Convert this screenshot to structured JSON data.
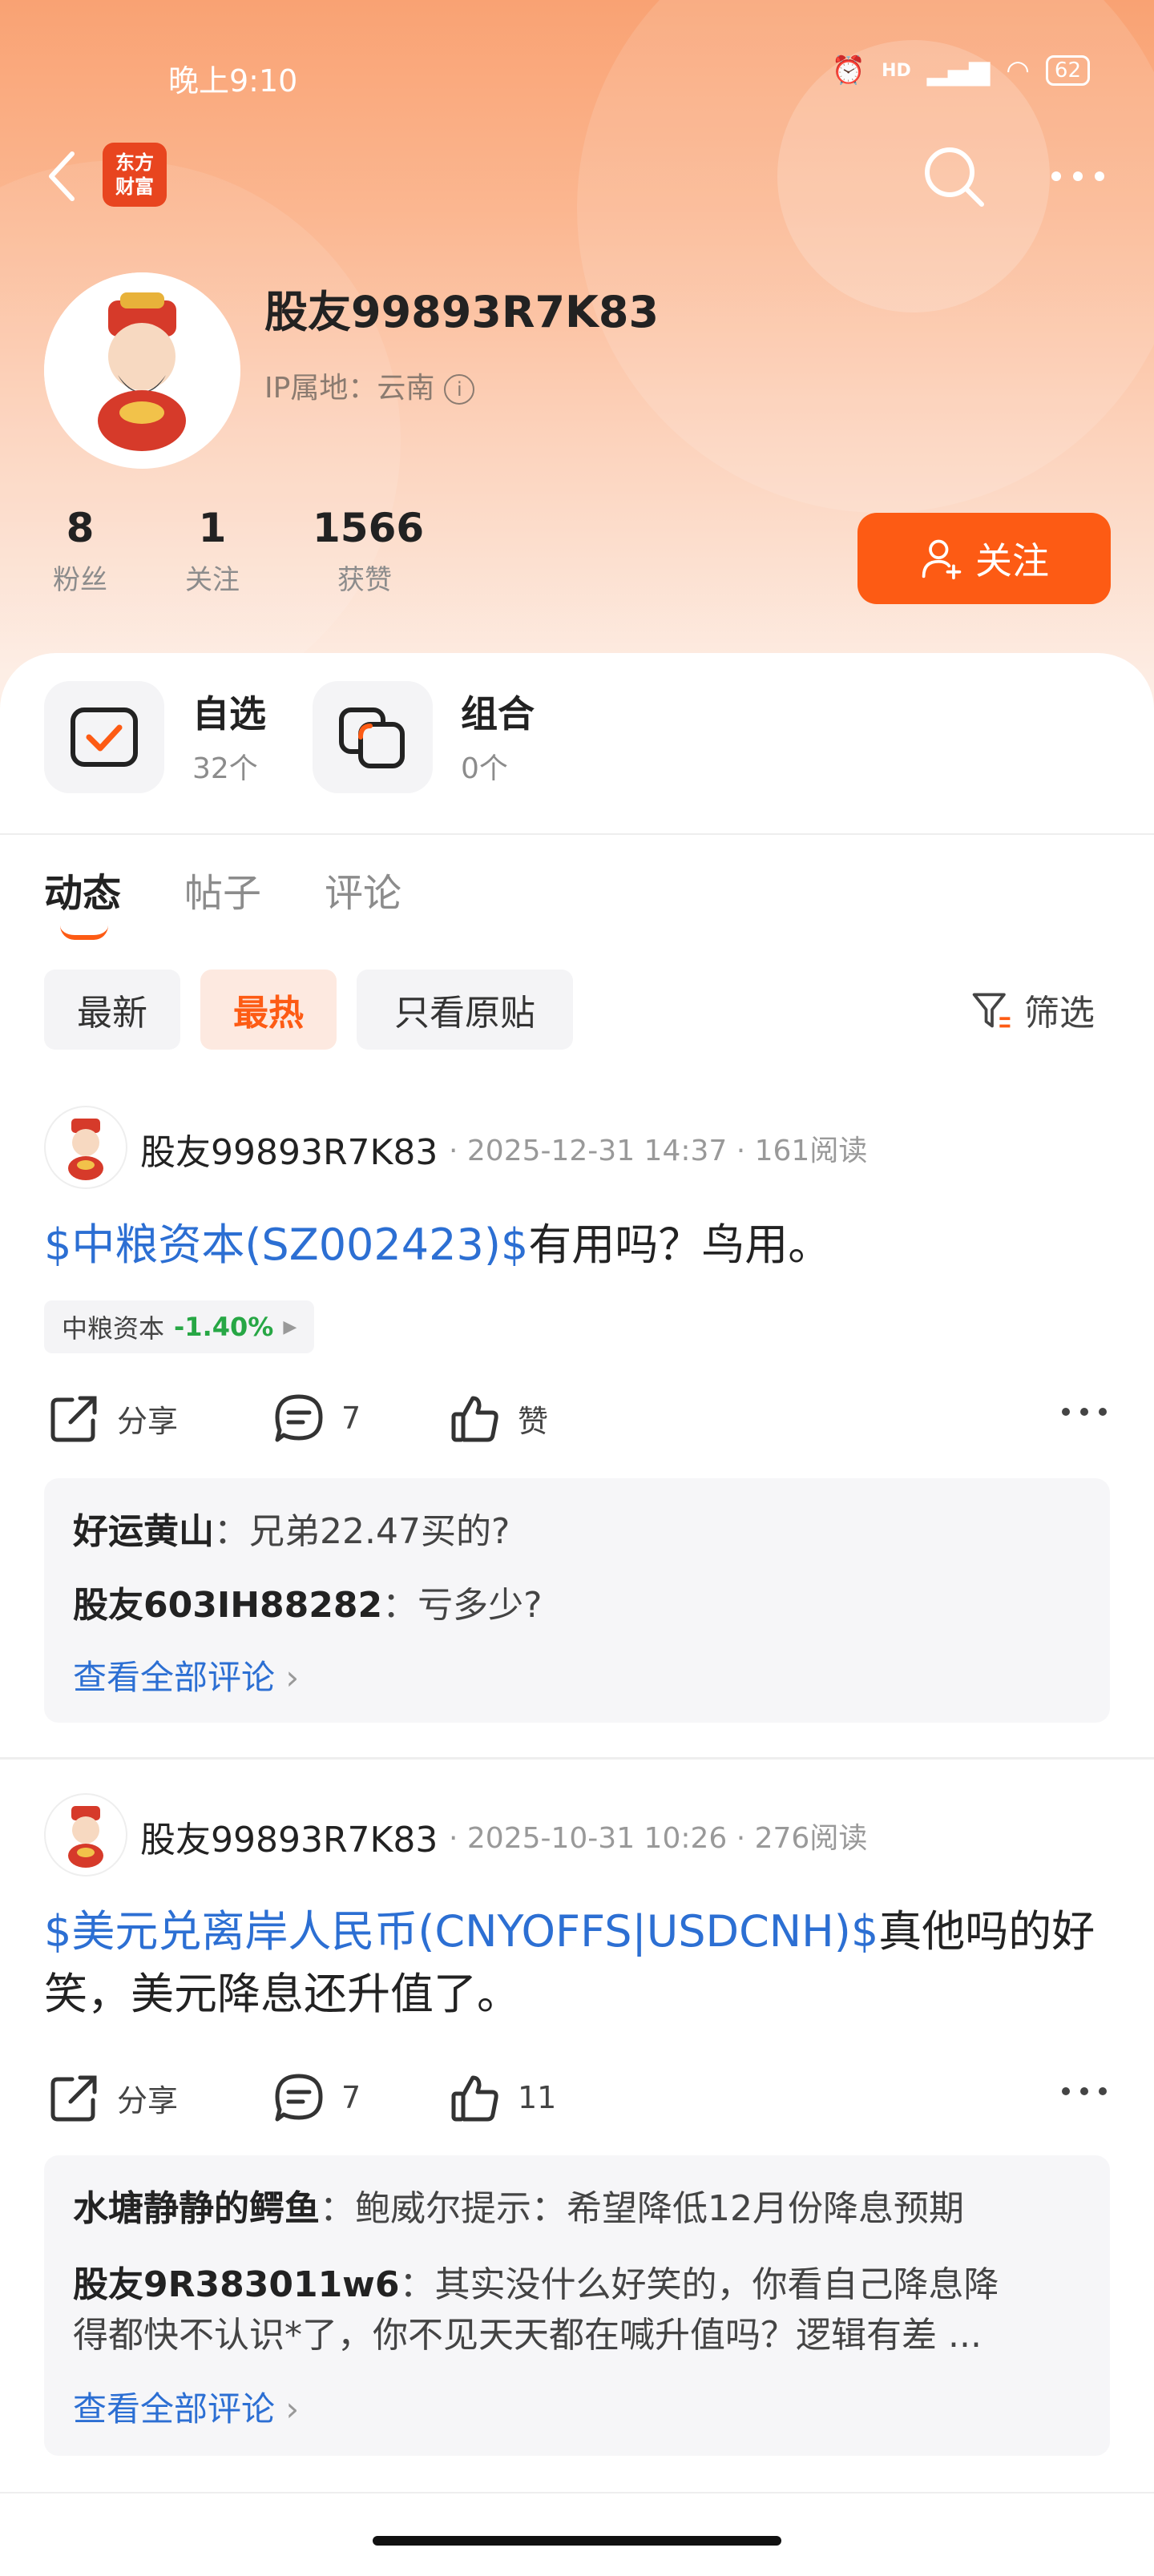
{
  "status": {
    "time": "晚上9:10",
    "signal": "HD",
    "battery": "62"
  },
  "brand": {
    "logo_line1": "东方",
    "logo_line2": "财富"
  },
  "profile": {
    "name": "股友99893R7K83",
    "ip_location": "IP属地：云南",
    "stats": [
      {
        "value": "8",
        "label": "粉丝"
      },
      {
        "value": "1",
        "label": "关注"
      },
      {
        "value": "1566",
        "label": "获赞"
      }
    ],
    "follow_label": "关注"
  },
  "quick": {
    "watchlist": {
      "title": "自选",
      "count": "32个"
    },
    "portfolio": {
      "title": "组合",
      "count": "0个"
    }
  },
  "tabs": [
    {
      "label": "动态",
      "active": true
    },
    {
      "label": "帖子"
    },
    {
      "label": "评论"
    }
  ],
  "filters": {
    "chips": [
      {
        "label": "最新"
      },
      {
        "label": "最热",
        "active": true
      },
      {
        "label": "只看原贴"
      }
    ],
    "filter_label": "筛选"
  },
  "posts": [
    {
      "author": "股友99893R7K83",
      "meta": "· 2025-12-31 14:37 · 161阅读",
      "link": "$中粮资本(SZ002423)$",
      "text": "有用吗？鸟用。",
      "stock_name": "中粮资本",
      "stock_change": "-1.40%",
      "share_label": "分享",
      "comment_count": "7",
      "like_label": "赞",
      "comments": [
        {
          "user": "好运黄山",
          "text": "兄弟22.47买的?"
        },
        {
          "user": "股友603IH88282",
          "text": "亏多少?"
        }
      ],
      "view_all": "查看全部评论"
    },
    {
      "author": "股友99893R7K83",
      "meta": "· 2025-10-31 10:26 · 276阅读",
      "link": "$美元兑离岸人民币(CNYOFFS|USDCNH)$",
      "text": "真他吗的好笑，美元降息还升值了。",
      "share_label": "分享",
      "comment_count": "7",
      "like_label": "11",
      "comments": [
        {
          "user": "水塘静静的鳄鱼",
          "text": "鲍威尔提示：希望降低12月份降息预期"
        },
        {
          "user": "股友9R383011w6",
          "text": "其实没什么好笑的，你看自己降息降",
          "text2": "得都快不认识*了，你不见天天都在喊升值吗？逻辑有差 ..."
        }
      ],
      "view_all": "查看全部评论"
    }
  ]
}
